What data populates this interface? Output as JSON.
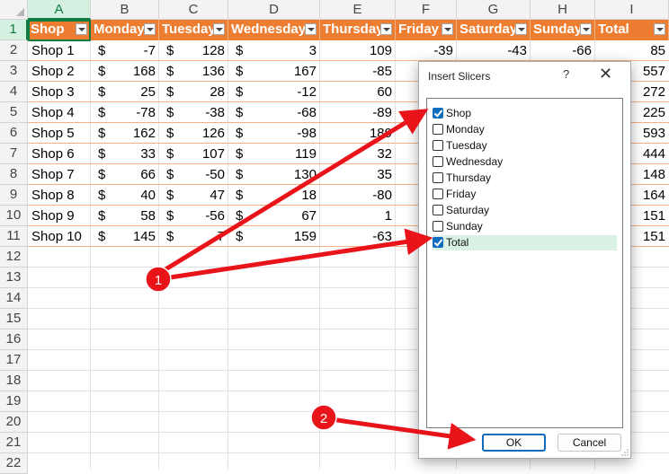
{
  "columns": [
    "A",
    "B",
    "C",
    "D",
    "E",
    "F",
    "G",
    "H",
    "I"
  ],
  "rows": [
    "1",
    "2",
    "3",
    "4",
    "5",
    "6",
    "7",
    "8",
    "9",
    "10",
    "11",
    "12",
    "13",
    "14",
    "15",
    "16",
    "17",
    "18",
    "19",
    "20",
    "21",
    "22"
  ],
  "headers": [
    "Shop",
    "Monday",
    "Tuesday",
    "Wednesday",
    "Thursday",
    "Friday",
    "Saturday",
    "Sunday",
    "Total"
  ],
  "table": [
    {
      "shop": "Shop 1",
      "cur": "$",
      "mon": "-7",
      "tue": "128",
      "wed": "3",
      "thu": "109",
      "fri": "-39",
      "sat": "-43",
      "sun": "-66",
      "total": "85"
    },
    {
      "shop": "Shop 2",
      "cur": "$",
      "mon": "168",
      "tue": "136",
      "wed": "167",
      "thu": "-85",
      "fri": "",
      "sat": "",
      "sun": "",
      "total": "557"
    },
    {
      "shop": "Shop 3",
      "cur": "$",
      "mon": "25",
      "tue": "28",
      "wed": "-12",
      "thu": "60",
      "fri": "",
      "sat": "",
      "sun": "",
      "total": "272"
    },
    {
      "shop": "Shop 4",
      "cur": "$",
      "mon": "-78",
      "tue": "-38",
      "wed": "-68",
      "thu": "-89",
      "fri": "",
      "sat": "",
      "sun": "",
      "total": "225"
    },
    {
      "shop": "Shop 5",
      "cur": "$",
      "mon": "162",
      "tue": "126",
      "wed": "-98",
      "thu": "189",
      "fri": "",
      "sat": "",
      "sun": "",
      "total": "593"
    },
    {
      "shop": "Shop 6",
      "cur": "$",
      "mon": "33",
      "tue": "107",
      "wed": "119",
      "thu": "32",
      "fri": "",
      "sat": "",
      "sun": "",
      "total": "444"
    },
    {
      "shop": "Shop 7",
      "cur": "$",
      "mon": "66",
      "tue": "-50",
      "wed": "130",
      "thu": "35",
      "fri": "",
      "sat": "",
      "sun": "",
      "total": "148"
    },
    {
      "shop": "Shop 8",
      "cur": "$",
      "mon": "40",
      "tue": "47",
      "wed": "18",
      "thu": "-80",
      "fri": "",
      "sat": "",
      "sun": "",
      "total": "164"
    },
    {
      "shop": "Shop 9",
      "cur": "$",
      "mon": "58",
      "tue": "-56",
      "wed": "67",
      "thu": "1",
      "fri": "",
      "sat": "",
      "sun": "",
      "total": "151"
    },
    {
      "shop": "Shop 10",
      "cur": "$",
      "mon": "145",
      "tue": "7",
      "wed": "159",
      "thu": "-63",
      "fri": "",
      "sat": "",
      "sun": "",
      "total": "151"
    }
  ],
  "dialog": {
    "title": "Insert Slicers",
    "help": "?",
    "close": "✕",
    "items": [
      {
        "label": "Shop",
        "checked": true
      },
      {
        "label": "Monday",
        "checked": false
      },
      {
        "label": "Tuesday",
        "checked": false
      },
      {
        "label": "Wednesday",
        "checked": false
      },
      {
        "label": "Thursday",
        "checked": false
      },
      {
        "label": "Friday",
        "checked": false
      },
      {
        "label": "Saturday",
        "checked": false
      },
      {
        "label": "Sunday",
        "checked": false
      },
      {
        "label": "Total",
        "checked": true
      }
    ],
    "ok": "OK",
    "cancel": "Cancel"
  },
  "callouts": [
    "1",
    "2"
  ],
  "colors": {
    "accent": "#ed7d31",
    "excel_green": "#107c41",
    "arrow": "#e8141a",
    "checkbox": "#0f6cbd"
  }
}
